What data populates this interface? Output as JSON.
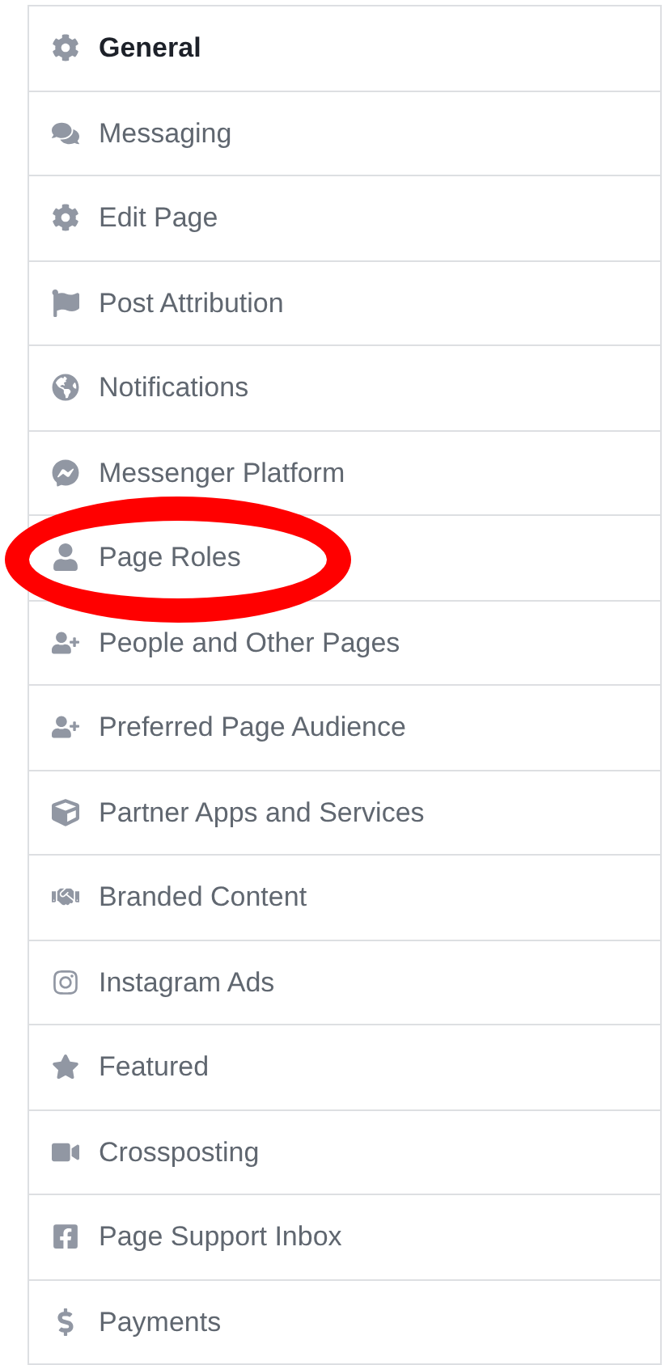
{
  "settings_menu": {
    "items": [
      {
        "label": "General",
        "selected": true,
        "circled": false
      },
      {
        "label": "Messaging",
        "selected": false,
        "circled": false
      },
      {
        "label": "Edit Page",
        "selected": false,
        "circled": false
      },
      {
        "label": "Post Attribution",
        "selected": false,
        "circled": false
      },
      {
        "label": "Notifications",
        "selected": false,
        "circled": false
      },
      {
        "label": "Messenger Platform",
        "selected": false,
        "circled": false
      },
      {
        "label": "Page Roles",
        "selected": false,
        "circled": true
      },
      {
        "label": "People and Other Pages",
        "selected": false,
        "circled": false
      },
      {
        "label": "Preferred Page Audience",
        "selected": false,
        "circled": false
      },
      {
        "label": "Partner Apps and Services",
        "selected": false,
        "circled": false
      },
      {
        "label": "Branded Content",
        "selected": false,
        "circled": false
      },
      {
        "label": "Instagram Ads",
        "selected": false,
        "circled": false
      },
      {
        "label": "Featured",
        "selected": false,
        "circled": false
      },
      {
        "label": "Crossposting",
        "selected": false,
        "circled": false
      },
      {
        "label": "Page Support Inbox",
        "selected": false,
        "circled": false
      },
      {
        "label": "Payments",
        "selected": false,
        "circled": false
      }
    ]
  }
}
